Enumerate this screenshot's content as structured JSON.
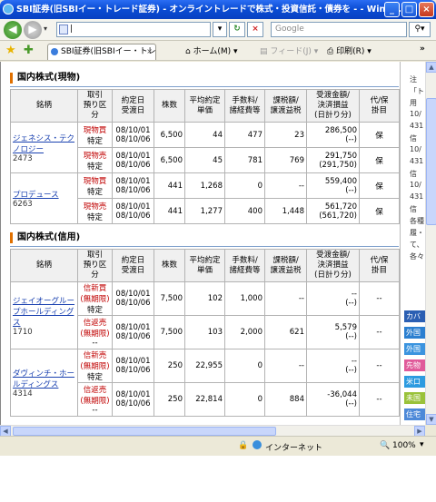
{
  "window": {
    "title": "SBI証券(旧SBIイー・トレード証券) - オンライントレードで株式・投資信託・債券を - - Wind...",
    "min": "_",
    "max": "□",
    "close": "×"
  },
  "address": {
    "url": "|",
    "search_placeholder": "Google"
  },
  "commandbar": {
    "tab_label": "SBI証券(旧SBIイー・トレー...",
    "home": "ホーム(M)",
    "feed": "フィード(J)",
    "print": "印刷(R)"
  },
  "status": {
    "zone": "インターネット",
    "zoom": "100%"
  },
  "genbutsu": {
    "title": "国内株式(現物)",
    "headers": [
      "銘柄",
      "取引\n預り区分",
      "約定日\n受渡日",
      "株数",
      "平均約定\n単価",
      "手数料/\n諸経費等",
      "課税額/\n譲渡益税",
      "受渡金額/\n決済損益\n(日計り分)",
      "代/保\n掛目"
    ],
    "stocks": [
      {
        "name": "ジェネシス・テクノロジー",
        "code": "2473",
        "rows": [
          {
            "type": "現物買",
            "account": "特定",
            "date1": "08/10/01",
            "date2": "08/10/06",
            "qty": "6,500",
            "price": "44",
            "fee": "477",
            "tax": "23",
            "amount": "286,500",
            "pl": "(--)",
            "kakeme": "保"
          },
          {
            "type": "現物売",
            "account": "特定",
            "date1": "08/10/01",
            "date2": "08/10/06",
            "qty": "6,500",
            "price": "45",
            "fee": "781",
            "tax": "769",
            "amount": "291,750",
            "pl": "(291,750)",
            "kakeme": "保"
          }
        ]
      },
      {
        "name": "プロデュース",
        "code": "6263",
        "rows": [
          {
            "type": "現物買",
            "account": "特定",
            "date1": "08/10/01",
            "date2": "08/10/06",
            "qty": "441",
            "price": "1,268",
            "fee": "0",
            "tax": "--",
            "amount": "559,400",
            "pl": "(--)",
            "kakeme": "保"
          },
          {
            "type": "現物売",
            "account": "特定",
            "date1": "08/10/01",
            "date2": "08/10/06",
            "qty": "441",
            "price": "1,277",
            "fee": "400",
            "tax": "1,448",
            "amount": "561,720",
            "pl": "(561,720)",
            "kakeme": "保"
          }
        ]
      }
    ]
  },
  "shinyo": {
    "title": "国内株式(信用)",
    "headers": [
      "銘柄",
      "取引\n預り区\n分",
      "約定日\n受渡日",
      "株数",
      "平均約定\n単価",
      "手数料/\n諸経費等",
      "課税額/\n譲渡益税",
      "受渡金額/\n決済損益\n(日計り分)",
      "代/保\n掛目"
    ],
    "stocks": [
      {
        "name": "ジェイオーグループホールディングス",
        "code": "1710",
        "rows": [
          {
            "type": "信新買",
            "sub": "(無期限)",
            "account": "特定",
            "date1": "08/10/01",
            "date2": "08/10/06",
            "qty": "7,500",
            "price": "102",
            "fee": "1,000",
            "tax": "--",
            "amount": "--",
            "pl": "(--)",
            "kakeme": "--"
          },
          {
            "type": "信返売",
            "sub": "(無期限)",
            "account": "--",
            "date1": "08/10/01",
            "date2": "08/10/06",
            "qty": "7,500",
            "price": "103",
            "fee": "2,000",
            "tax": "621",
            "amount": "5,579",
            "pl": "(--)",
            "kakeme": "--"
          }
        ]
      },
      {
        "name": "ダヴィンチ・ホールディングス",
        "code": "4314",
        "rows": [
          {
            "type": "信新売",
            "sub": "(無期限)",
            "account": "特定",
            "date1": "08/10/01",
            "date2": "08/10/06",
            "qty": "250",
            "price": "22,955",
            "fee": "0",
            "tax": "--",
            "amount": "--",
            "pl": "(--)",
            "kakeme": "--"
          },
          {
            "type": "信返売",
            "sub": "(無期限)",
            "account": "--",
            "date1": "08/10/01",
            "date2": "08/10/06",
            "qty": "250",
            "price": "22,814",
            "fee": "0",
            "tax": "884",
            "amount": "-36,044",
            "pl": "(--)",
            "kakeme": "--"
          }
        ]
      }
    ]
  },
  "side": {
    "items": [
      "注",
      "「ト",
      "用",
      "10/",
      "431",
      "信",
      "10/",
      "431",
      "信",
      "10/",
      "431",
      "信",
      "各種",
      "履・",
      "て、",
      "各々"
    ],
    "buttons": [
      {
        "label": "カバ",
        "color": "#2b5fb3"
      },
      {
        "label": "外国",
        "color": "#2b7fd0"
      },
      {
        "label": "外国",
        "color": "#3b94df"
      },
      {
        "label": "先物",
        "color": "#e05a9a"
      },
      {
        "label": "米口",
        "color": "#2c9be0"
      },
      {
        "label": "未国",
        "color": "#9ac23a"
      },
      {
        "label": "住宅",
        "color": "#4d89d8"
      }
    ]
  }
}
